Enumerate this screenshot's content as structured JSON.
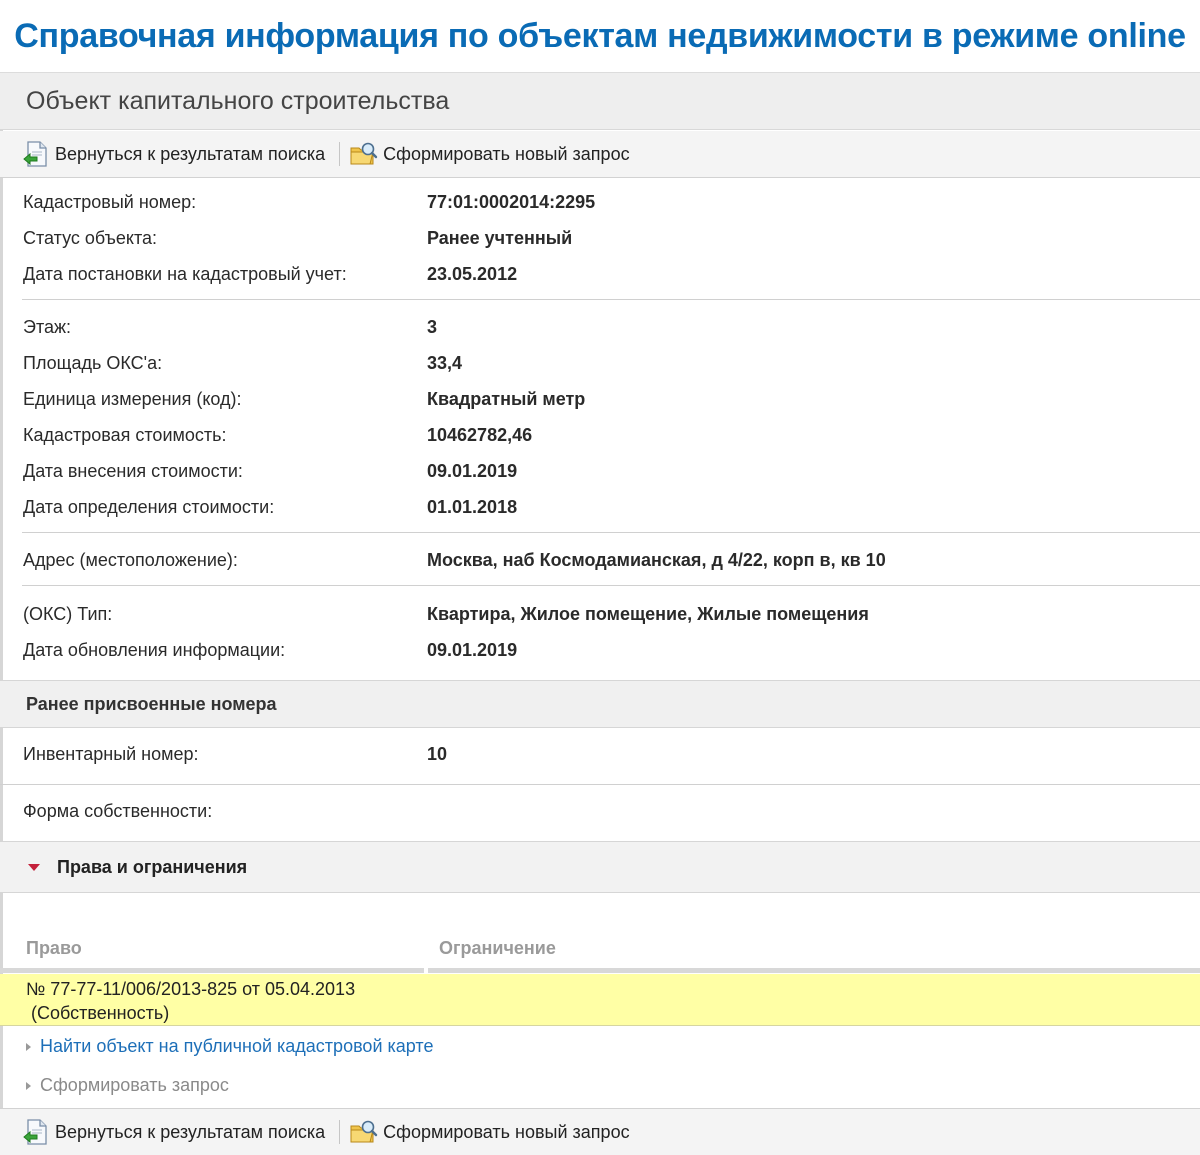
{
  "banner": "Справочная информация по объектам недвижимости в режиме online",
  "page_title": "Объект капитального строительства",
  "toolbar": {
    "back_label": "Вернуться к результатам поиска",
    "new_request_label": "Сформировать новый запрос"
  },
  "group1": [
    {
      "label": "Кадастровый номер:",
      "value": "77:01:0002014:2295"
    },
    {
      "label": "Статус объекта:",
      "value": "Ранее учтенный"
    },
    {
      "label": "Дата постановки на кадастровый учет:",
      "value": "23.05.2012"
    }
  ],
  "group2": [
    {
      "label": "Этаж:",
      "value": "3"
    },
    {
      "label": "Площадь ОКС'а:",
      "value": "33,4"
    },
    {
      "label": "Единица измерения (код):",
      "value": "Квадратный метр"
    },
    {
      "label": "Кадастровая стоимость:",
      "value": "10462782,46"
    },
    {
      "label": "Дата внесения стоимости:",
      "value": "09.01.2019"
    },
    {
      "label": "Дата определения стоимости:",
      "value": "01.01.2018"
    }
  ],
  "group3": [
    {
      "label": "Адрес (местоположение):",
      "value": "Москва, наб Космодамианская, д 4/22, корп в, кв 10"
    }
  ],
  "group4": [
    {
      "label": "(ОКС) Тип:",
      "value": "Квартира, Жилое помещение, Жилые помещения"
    },
    {
      "label": "Дата обновления информации:",
      "value": "09.01.2019"
    }
  ],
  "previous_numbers": {
    "title": "Ранее присвоенные номера",
    "rows": [
      {
        "label": "Инвентарный номер:",
        "value": "10"
      },
      {
        "label": "Форма собственности:",
        "value": ""
      }
    ]
  },
  "rights": {
    "title": "Права и ограничения",
    "columns": [
      "Право",
      "Ограничение"
    ],
    "entries": [
      {
        "line1": "№ 77-77-11/006/2013-825  от 05.04.2013",
        "line2": "(Собственность)",
        "restriction": ""
      }
    ]
  },
  "links": {
    "find_on_map": "Найти объект на публичной кадастровой карте",
    "make_request": "Сформировать запрос"
  },
  "colors": {
    "banner_text": "#0a6bb5",
    "highlight_row": "#ffffa5",
    "link": "#1d6fb8",
    "collapse_triangle": "#c4213b"
  }
}
